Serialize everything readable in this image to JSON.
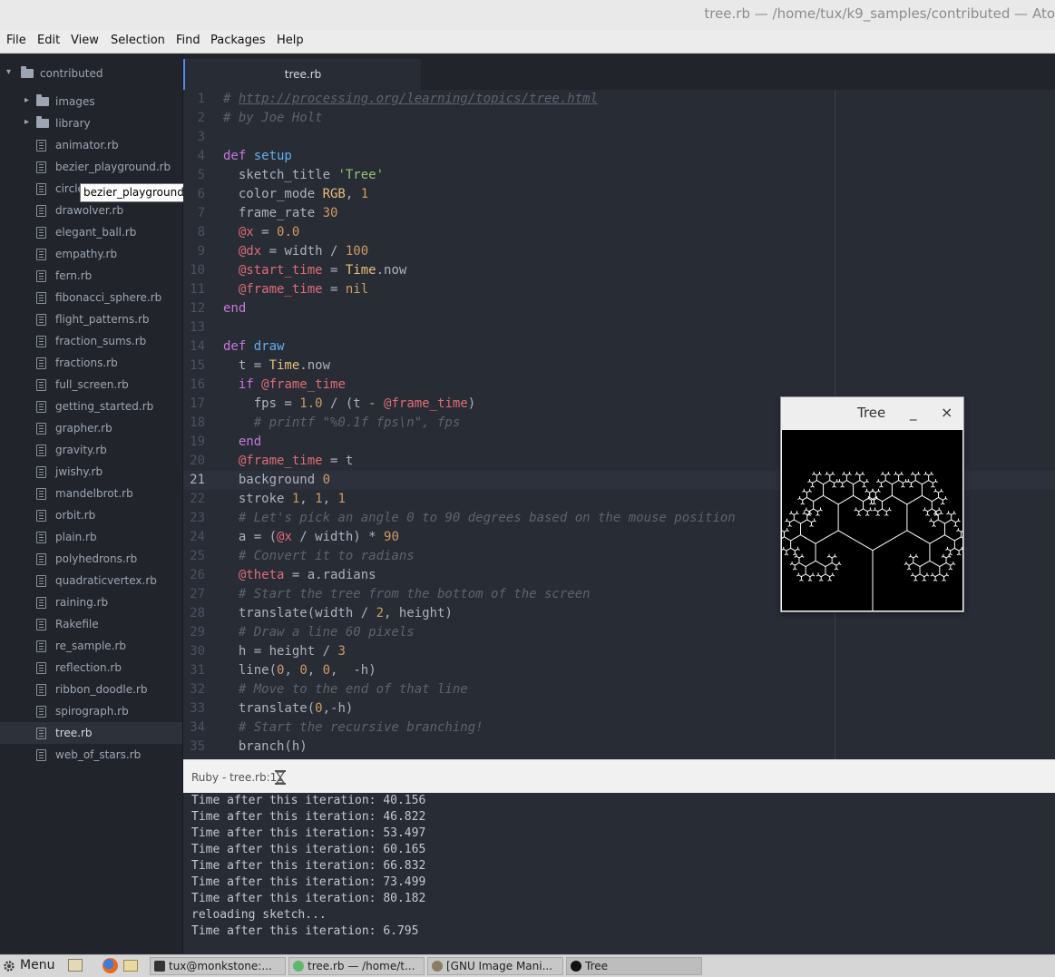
{
  "window": {
    "title": "tree.rb — /home/tux/k9_samples/contributed — Ato"
  },
  "menu": [
    "File",
    "Edit",
    "View",
    "Selection",
    "Find",
    "Packages",
    "Help"
  ],
  "tree": {
    "root": "contributed",
    "folders": [
      "images",
      "library"
    ],
    "files": [
      "animator.rb",
      "bezier_playground.rb",
      "circle",
      "drawolver.rb",
      "elegant_ball.rb",
      "empathy.rb",
      "fern.rb",
      "fibonacci_sphere.rb",
      "flight_patterns.rb",
      "fraction_sums.rb",
      "fractions.rb",
      "full_screen.rb",
      "getting_started.rb",
      "grapher.rb",
      "gravity.rb",
      "jwishy.rb",
      "mandelbrot.rb",
      "orbit.rb",
      "plain.rb",
      "polyhedrons.rb",
      "quadraticvertex.rb",
      "raining.rb",
      "Rakefile",
      "re_sample.rb",
      "reflection.rb",
      "ribbon_doodle.rb",
      "spirograph.rb",
      "tree.rb",
      "web_of_stars.rb"
    ],
    "selected": "tree.rb"
  },
  "tooltip": "bezier_playground.rb",
  "tab": {
    "label": "tree.rb"
  },
  "editor": {
    "current_line": 21,
    "lines": [
      [
        [
          "# ",
          "comment"
        ],
        [
          "http://processing.org/learning/topics/tree.html",
          "link"
        ]
      ],
      [
        [
          "# by Joe Holt",
          "comment"
        ]
      ],
      [],
      [
        [
          "def ",
          "keyword"
        ],
        [
          "setup",
          "func"
        ]
      ],
      [
        [
          "  sketch_title ",
          "plain"
        ],
        [
          "'Tree'",
          "string"
        ]
      ],
      [
        [
          "  color_mode ",
          "plain"
        ],
        [
          "RGB",
          "const"
        ],
        [
          ", ",
          "plain"
        ],
        [
          "1",
          "number"
        ]
      ],
      [
        [
          "  frame_rate ",
          "plain"
        ],
        [
          "30",
          "number"
        ]
      ],
      [
        [
          "  ",
          "plain"
        ],
        [
          "@x",
          "ivar"
        ],
        [
          " = ",
          "plain"
        ],
        [
          "0.0",
          "number"
        ]
      ],
      [
        [
          "  ",
          "plain"
        ],
        [
          "@dx",
          "ivar"
        ],
        [
          " = width / ",
          "plain"
        ],
        [
          "100",
          "number"
        ]
      ],
      [
        [
          "  ",
          "plain"
        ],
        [
          "@start_time",
          "ivar"
        ],
        [
          " = ",
          "plain"
        ],
        [
          "Time",
          "const"
        ],
        [
          ".now",
          "plain"
        ]
      ],
      [
        [
          "  ",
          "plain"
        ],
        [
          "@frame_time",
          "ivar"
        ],
        [
          " = ",
          "plain"
        ],
        [
          "nil",
          "number"
        ]
      ],
      [
        [
          "end",
          "keyword"
        ]
      ],
      [],
      [
        [
          "def ",
          "keyword"
        ],
        [
          "draw",
          "func"
        ]
      ],
      [
        [
          "  t = ",
          "plain"
        ],
        [
          "Time",
          "const"
        ],
        [
          ".now",
          "plain"
        ]
      ],
      [
        [
          "  ",
          "plain"
        ],
        [
          "if ",
          "keyword"
        ],
        [
          "@frame_time",
          "ivar"
        ]
      ],
      [
        [
          "    fps = ",
          "plain"
        ],
        [
          "1.0",
          "number"
        ],
        [
          " / (t - ",
          "plain"
        ],
        [
          "@frame_time",
          "ivar"
        ],
        [
          ")",
          "plain"
        ]
      ],
      [
        [
          "    # printf \"%0.1f fps\\n\", fps",
          "comment"
        ]
      ],
      [
        [
          "  ",
          "plain"
        ],
        [
          "end",
          "keyword"
        ]
      ],
      [
        [
          "  ",
          "plain"
        ],
        [
          "@frame_time",
          "ivar"
        ],
        [
          " = t",
          "plain"
        ]
      ],
      [
        [
          "  background ",
          "plain"
        ],
        [
          "0",
          "number"
        ]
      ],
      [
        [
          "  stroke ",
          "plain"
        ],
        [
          "1",
          "number"
        ],
        [
          ", ",
          "plain"
        ],
        [
          "1",
          "number"
        ],
        [
          ", ",
          "plain"
        ],
        [
          "1",
          "number"
        ]
      ],
      [
        [
          "  # Let's pick an angle 0 to 90 degrees based on the mouse position",
          "comment"
        ]
      ],
      [
        [
          "  a = (",
          "plain"
        ],
        [
          "@x",
          "ivar"
        ],
        [
          " / width) * ",
          "plain"
        ],
        [
          "90",
          "number"
        ]
      ],
      [
        [
          "  # Convert it to radians",
          "comment"
        ]
      ],
      [
        [
          "  ",
          "plain"
        ],
        [
          "@theta",
          "ivar"
        ],
        [
          " = a.radians",
          "plain"
        ]
      ],
      [
        [
          "  # Start the tree from the bottom of the screen",
          "comment"
        ]
      ],
      [
        [
          "  translate(width / ",
          "plain"
        ],
        [
          "2",
          "number"
        ],
        [
          ", height)",
          "plain"
        ]
      ],
      [
        [
          "  # Draw a line 60 pixels",
          "comment"
        ]
      ],
      [
        [
          "  h = height / ",
          "plain"
        ],
        [
          "3",
          "number"
        ]
      ],
      [
        [
          "  line(",
          "plain"
        ],
        [
          "0",
          "number"
        ],
        [
          ", ",
          "plain"
        ],
        [
          "0",
          "number"
        ],
        [
          ", ",
          "plain"
        ],
        [
          "0",
          "number"
        ],
        [
          ",  -h)",
          "plain"
        ]
      ],
      [
        [
          "  # Move to the end of that line",
          "comment"
        ]
      ],
      [
        [
          "  translate(",
          "plain"
        ],
        [
          "0",
          "number"
        ],
        [
          ",-h)",
          "plain"
        ]
      ],
      [
        [
          "  # Start the recursive branching!",
          "comment"
        ]
      ],
      [
        [
          "  branch(h)",
          "plain"
        ]
      ]
    ]
  },
  "status": {
    "text": "Ruby - tree.rb:1",
    "icon": "hourglass-icon"
  },
  "console": {
    "lines": [
      "Time after this iteration: 40.156",
      "Time after this iteration: 46.822",
      "Time after this iteration: 53.497",
      "Time after this iteration: 60.165",
      "Time after this iteration: 66.832",
      "Time after this iteration: 73.499",
      "Time after this iteration: 80.182",
      "reloading sketch...",
      "Time after this iteration: 6.795"
    ]
  },
  "sketch_window": {
    "title": "Tree",
    "minimize": "_",
    "close": "×"
  },
  "taskbar": {
    "menu_label": "Menu",
    "tasks": [
      "tux@monkstone:...",
      "tree.rb — /home/t...",
      "[GNU Image Mani...",
      "Tree"
    ]
  },
  "colors": {
    "comment": "#5c6370",
    "link": "#5c6370",
    "keyword": "#c678dd",
    "func": "#61afef",
    "string": "#98c379",
    "const": "#e5c07b",
    "number": "#d19a66",
    "ivar": "#e06c75",
    "plain": "#abb2bf"
  }
}
